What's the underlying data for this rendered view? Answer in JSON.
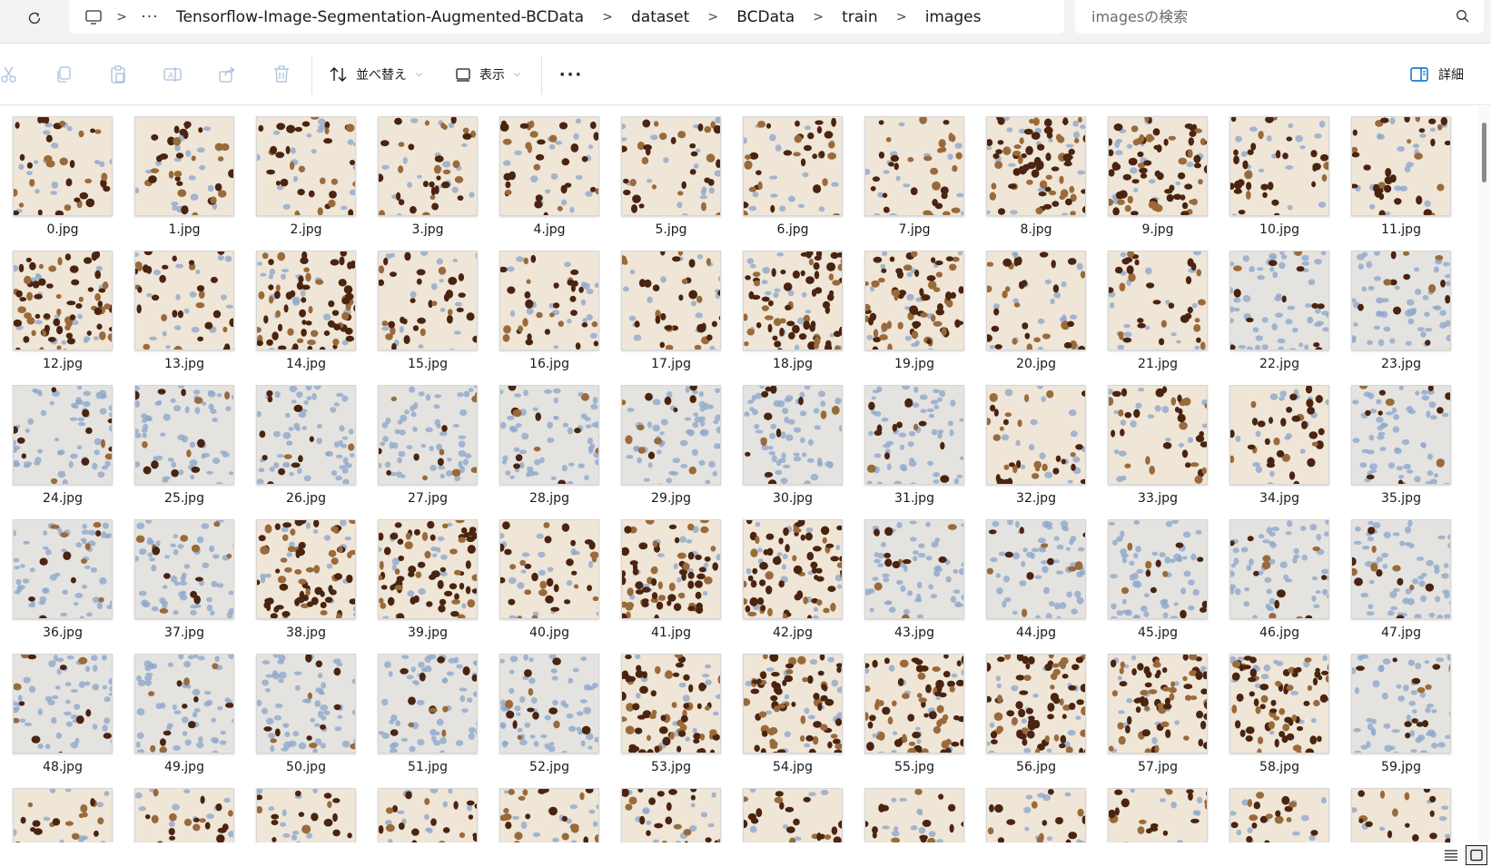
{
  "breadcrumb": {
    "items": [
      "Tensorflow-Image-Segmentation-Augmented-BCData",
      "dataset",
      "BCData",
      "train",
      "images"
    ],
    "ellipsis": "···"
  },
  "search": {
    "placeholder": "imagesの検索"
  },
  "toolbar": {
    "sort_label": "並べ替え",
    "view_label": "表示",
    "more_label": "···",
    "details_label": "詳細"
  },
  "files": [
    "0.jpg",
    "1.jpg",
    "2.jpg",
    "3.jpg",
    "4.jpg",
    "5.jpg",
    "6.jpg",
    "7.jpg",
    "8.jpg",
    "9.jpg",
    "10.jpg",
    "11.jpg",
    "12.jpg",
    "13.jpg",
    "14.jpg",
    "15.jpg",
    "16.jpg",
    "17.jpg",
    "18.jpg",
    "19.jpg",
    "20.jpg",
    "21.jpg",
    "22.jpg",
    "23.jpg",
    "24.jpg",
    "25.jpg",
    "26.jpg",
    "27.jpg",
    "28.jpg",
    "29.jpg",
    "30.jpg",
    "31.jpg",
    "32.jpg",
    "33.jpg",
    "34.jpg",
    "35.jpg",
    "36.jpg",
    "37.jpg",
    "38.jpg",
    "39.jpg",
    "40.jpg",
    "41.jpg",
    "42.jpg",
    "43.jpg",
    "44.jpg",
    "45.jpg",
    "46.jpg",
    "47.jpg",
    "48.jpg",
    "49.jpg",
    "50.jpg",
    "51.jpg",
    "52.jpg",
    "53.jpg",
    "54.jpg",
    "55.jpg",
    "56.jpg",
    "57.jpg",
    "58.jpg",
    "59.jpg",
    "",
    "",
    "",
    "",
    "",
    "",
    "",
    "",
    "",
    "",
    "",
    ""
  ],
  "colors": {
    "stain_brown": "#4a2410",
    "stain_light_brown": "#9a6a3a",
    "stain_blue": "#8fa8cc",
    "tissue_bg": "#efe6d8",
    "accent": "#0067c0"
  }
}
